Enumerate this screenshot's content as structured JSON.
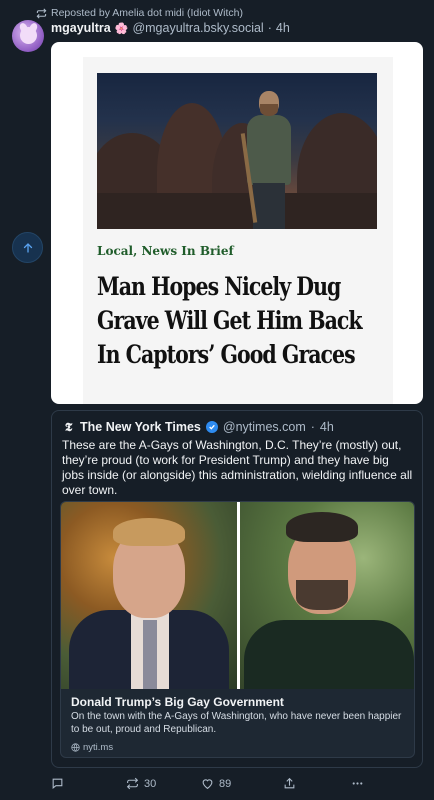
{
  "repost": {
    "text": "Reposted by Amelia dot midi (Idiot Witch)"
  },
  "post": {
    "author_name": "mgayultra",
    "author_emoji": "🌸",
    "author_handle": "@mgayultra.bsky.social",
    "sep": "·",
    "time": "4h",
    "image": {
      "kicker": "Local, News In Brief",
      "headline": "Man Hopes Nicely Dug Grave Will Get Him Back In Captors’ Good Graces"
    }
  },
  "quote": {
    "name": "The New York Times",
    "handle": "@nytimes.com",
    "sep": "·",
    "time": "4h",
    "text": "These are the A-Gays of Washington, D.C. They’re (mostly) out, they’re proud (to work for President Trump) and they have big jobs inside (or alongside) this administration, wielding influence all over town.",
    "embed": {
      "title": "Donald Trump’s Big Gay Government",
      "description": "On the town with the A-Gays of Washington, who have never been happier to be out, proud and Republican.",
      "domain": "nyti.ms"
    }
  },
  "actions": {
    "reposts": "30",
    "likes": "89"
  },
  "colors": {
    "background": "#161e27",
    "accent": "#2e8bf0",
    "muted": "#aebbc9",
    "kicker": "#1f5c2a"
  }
}
